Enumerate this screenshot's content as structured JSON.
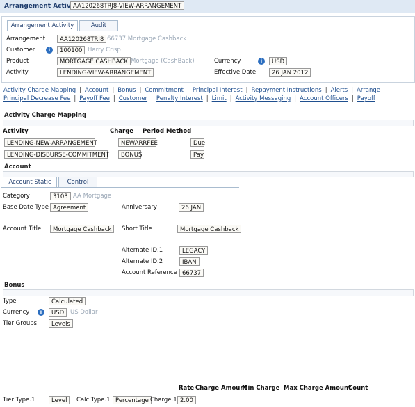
{
  "title": {
    "label": "Arrangement Activity",
    "value": "AA120268TRJ8-VIEW-ARRANGEMENT"
  },
  "header_tabs": [
    "Arrangement Activity",
    "Audit"
  ],
  "header": {
    "arrangement_label": "Arrangement",
    "arrangement_value": "AA120268TRJ8",
    "arrangement_desc": "66737 Mortgage Cashback",
    "customer_label": "Customer",
    "customer_value": "100100",
    "customer_desc": "Harry Crisp",
    "product_label": "Product",
    "product_value": "MORTGAGE.CASHBACK",
    "product_desc": "Mortgage (CashBack)",
    "activity_label": "Activity",
    "activity_value": "LENDING-VIEW-ARRANGEMENT",
    "currency_label": "Currency",
    "currency_value": "USD",
    "effective_label": "Effective Date",
    "effective_value": "26 JAN 2012"
  },
  "links_row1": [
    "Activity Charge Mapping",
    "Account",
    "Bonus",
    "Commitment",
    "Principal Interest",
    "Repayment Instructions",
    "Alerts",
    "Arrange"
  ],
  "links_row2": [
    "Principal Decrease Fee",
    "Payoff Fee",
    "Customer",
    "Penalty Interest",
    "Limit",
    "Activity Messaging",
    "Account Officers",
    "Payoff"
  ],
  "acm": {
    "section": "Activity Charge Mapping",
    "col_activity": "Activity",
    "col_charge": "Charge",
    "col_method": "Period Method",
    "rows": [
      {
        "activity": "LENDING-NEW-ARRANGEMENT",
        "charge": "NEWARRFEE",
        "method": "Due"
      },
      {
        "activity": "LENDING-DISBURSE-COMMITMENT",
        "charge": "BONUS",
        "method": "Pay"
      }
    ]
  },
  "account": {
    "section": "Account",
    "tabs": [
      "Account Static",
      "Control"
    ],
    "category_label": "Category",
    "category_value": "3103",
    "category_desc": "AA Mortgage",
    "base_date_label": "Base Date Type",
    "base_date_value": "Agreement",
    "anniversary_label": "Anniversary",
    "anniversary_value": "26 JAN",
    "account_title_label": "Account Title",
    "account_title_value": "Mortgage Cashback",
    "short_title_label": "Short Title",
    "short_title_value": "Mortgage Cashback",
    "alt1_label": "Alternate ID.1",
    "alt1_value": "LEGACY",
    "alt2_label": "Alternate ID.2",
    "alt2_value": "IBAN",
    "acct_ref_label": "Account Reference",
    "acct_ref_value": "66737"
  },
  "bonus": {
    "section": "Bonus",
    "type_label": "Type",
    "type_value": "Calculated",
    "currency_label": "Currency",
    "currency_value": "USD",
    "currency_desc": "US Dollar",
    "tier_groups_label": "Tier Groups",
    "tier_groups_value": "Levels",
    "col_rate": "Rate",
    "col_charge_amount": "Charge Amount",
    "col_min_charge": "Min Charge",
    "col_max_charge": "Max Charge Amount",
    "col_count": "Count",
    "tier_type_label": "Tier Type.1",
    "tier_type_value": "Level",
    "calc_type_label": "Calc Type.1",
    "calc_type_value": "Percentage",
    "charge_label": "Charge.1",
    "charge_value": "2.00"
  },
  "icons": {
    "info": "info-icon"
  },
  "colors": {
    "link": "#1f4f8f",
    "title_bar": "#dfe9f4",
    "title_text": "#1f3d6d",
    "info_icon": "#2d6fc0",
    "grey_desc": "#9aa7b6"
  }
}
